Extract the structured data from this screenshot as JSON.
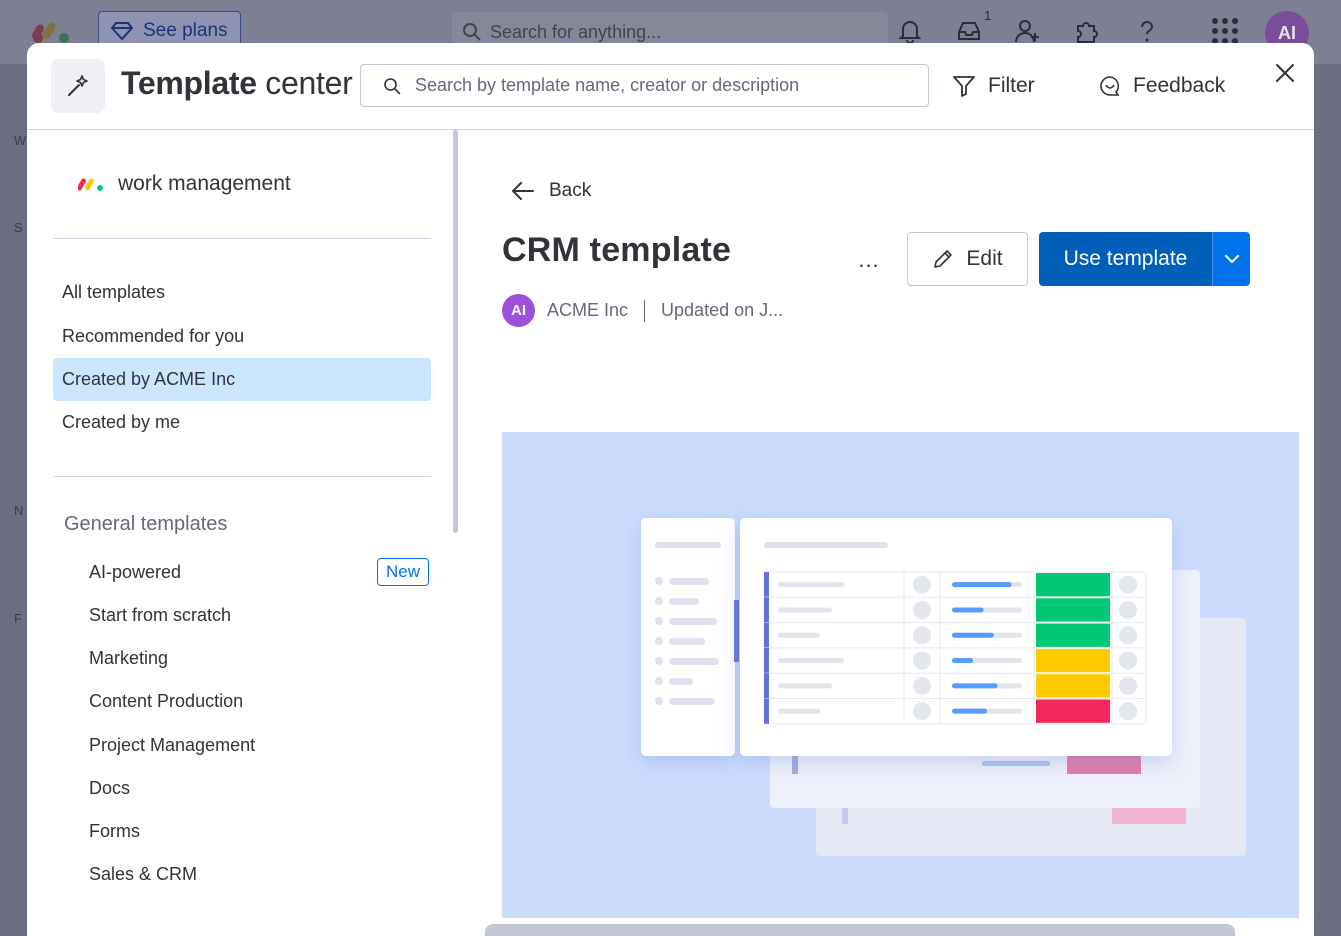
{
  "background": {
    "see_plans_label": "See plans",
    "search_placeholder": "Search for anything...",
    "inbox_badge": "1",
    "avatar_initials": "AI",
    "side_letters": [
      "W",
      "S",
      "N",
      "F"
    ]
  },
  "header": {
    "title_bold": "Template",
    "title_rest": " center",
    "search_placeholder": "Search by template name, creator or description",
    "filter_label": "Filter",
    "feedback_label": "Feedback"
  },
  "sidebar": {
    "brand_label": "work management",
    "nav_items": [
      {
        "label": "All templates"
      },
      {
        "label": "Recommended for you"
      },
      {
        "label": "Created by ACME Inc",
        "active": true
      },
      {
        "label": "Created by me"
      }
    ],
    "section_title": "General templates",
    "categories": [
      {
        "label": "AI-powered",
        "badge": "New"
      },
      {
        "label": "Start from scratch"
      },
      {
        "label": "Marketing"
      },
      {
        "label": "Content Production"
      },
      {
        "label": "Project Management"
      },
      {
        "label": "Docs"
      },
      {
        "label": "Forms"
      },
      {
        "label": "Sales & CRM"
      }
    ]
  },
  "main": {
    "back_label": "Back",
    "template_title": "CRM template",
    "more_label": "...",
    "edit_label": "Edit",
    "use_template_label": "Use template",
    "creator_initials": "AI",
    "creator_name": "ACME Inc",
    "updated_text": "Updated on J...",
    "status_colors": [
      "#00c875",
      "#00c875",
      "#00c875",
      "#ffcb00",
      "#ffcb00",
      "#f2295b"
    ],
    "progress_fractions": [
      0.85,
      0.45,
      0.6,
      0.3,
      0.65,
      0.5
    ]
  },
  "colors": {
    "primary": "#0073ea",
    "primary_dark": "#0060b9",
    "active_nav": "#cce5ff",
    "preview_bg": "#cbdcfd"
  }
}
